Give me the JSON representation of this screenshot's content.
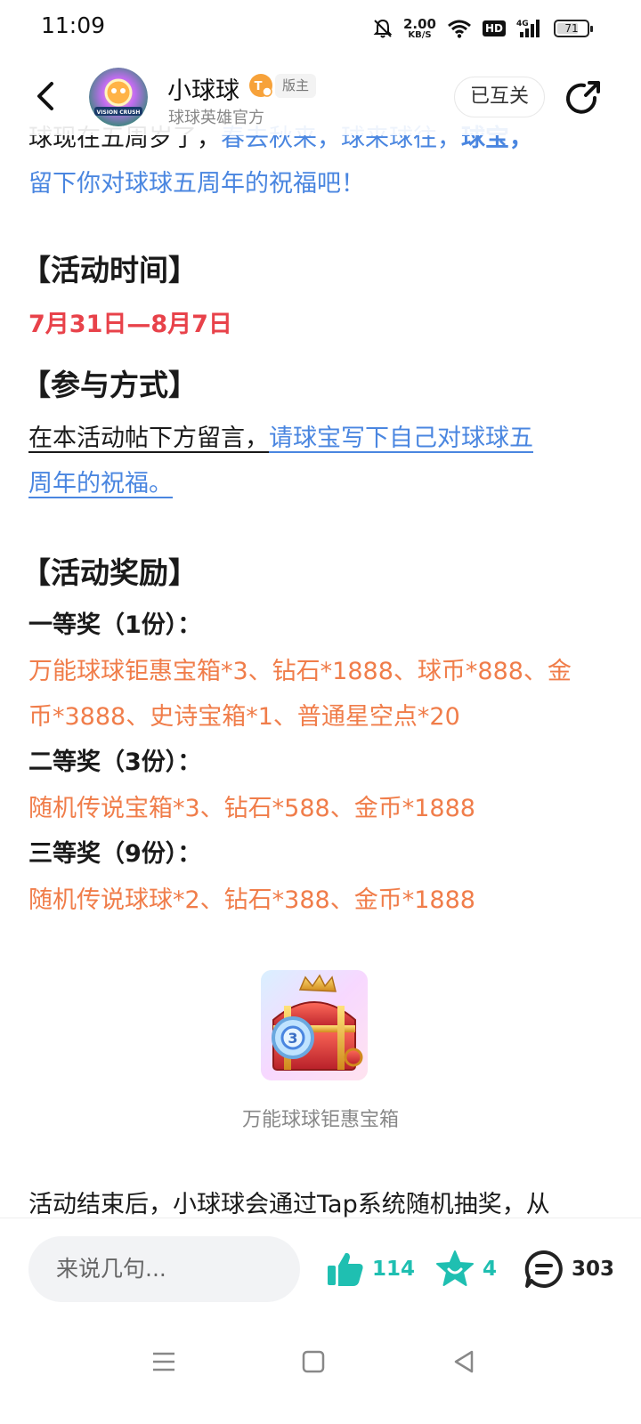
{
  "status_bar": {
    "time": "11:09",
    "net_speed": "2.00",
    "net_unit": "KB/S",
    "hd": "HD",
    "network": "4G",
    "battery": "71",
    "battery_level": 0.71
  },
  "header": {
    "author_name": "小球球",
    "role_badge": "版主",
    "author_subtitle": "球球英雄官方",
    "follow_label": "已互关",
    "avatar_text": "VISION CRUSH"
  },
  "article": {
    "intro_line1_black": "球现在五周岁了，",
    "intro_line1_blue": "春去秋来，球来球往，",
    "intro_line1_blue_bold": "球宝，",
    "intro_line2": "留下你对球球五周年的祝福吧！",
    "section_time": "【活动时间】",
    "date_range": "7月31日—8月7日",
    "section_join": "【参与方式】",
    "join_line1_black": "在本活动帖下方留言，",
    "join_line1_blue": "请球宝写下自己对球球五",
    "join_line2_blue": "周年的祝福。",
    "section_reward": "【活动奖励】",
    "prize1_title": "一等奖（1份）：",
    "prize1_line1": "万能球球钜惠宝箱*3、钻石*1888、球币*888、金",
    "prize1_line2": "币*3888、史诗宝箱*1、普通星空点*20",
    "prize2_title": "二等奖（3份）：",
    "prize2_line": "随机传说宝箱*3、钻石*588、金币*1888",
    "prize3_title": "三等奖（9份）：",
    "prize3_line": "随机传说球球*2、钻石*388、金币*1888",
    "image_caption": "万能球球钜惠宝箱",
    "outro_prefix": "活动结束后，小球球会通过",
    "outro_link": "Tap系统随机抽奖",
    "outro_suffix": "，从"
  },
  "bottom_bar": {
    "comment_placeholder": "来说几句...",
    "like_count": "114",
    "fav_count": "4",
    "comment_count": "303"
  },
  "colors": {
    "link_blue": "#4a86e0",
    "date_red": "#e8424a",
    "reward_orange": "#f07d4a",
    "action_teal": "#1fbfb1"
  },
  "icons": [
    "mute-bell-icon",
    "wifi-icon",
    "signal-icon",
    "battery-icon",
    "back-arrow-icon",
    "share-icon",
    "level-badge-icon",
    "like-thumb-icon",
    "favorite-star-icon",
    "comment-bubble-icon",
    "menu-nav-icon",
    "home-nav-icon",
    "back-nav-icon"
  ]
}
